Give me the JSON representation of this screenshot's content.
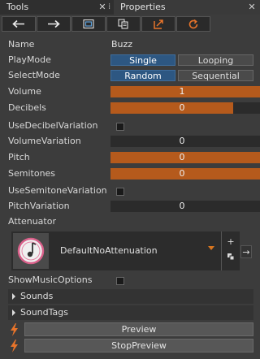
{
  "tabs": {
    "tools": "Tools",
    "properties": "Properties",
    "close_glyph": "✕"
  },
  "toolbar": {
    "icons": [
      "arrow-left-icon",
      "arrow-right-icon",
      "select-frame-icon",
      "copy-paste-icon",
      "open-external-icon",
      "refresh-icon"
    ]
  },
  "properties": {
    "name": {
      "label": "Name",
      "value": "Buzz"
    },
    "play_mode": {
      "label": "PlayMode",
      "options": [
        "Single",
        "Looping"
      ],
      "selected": "Single"
    },
    "select_mode": {
      "label": "SelectMode",
      "options": [
        "Random",
        "Sequential"
      ],
      "selected": "Random"
    },
    "volume": {
      "label": "Volume",
      "value": "1",
      "fill": 1.0
    },
    "decibels": {
      "label": "Decibels",
      "value": "0",
      "fill": 0.82
    },
    "use_decibel_variation": {
      "label": "UseDecibelVariation",
      "checked": false
    },
    "volume_variation": {
      "label": "VolumeVariation",
      "value": "0",
      "fill": 0
    },
    "pitch": {
      "label": "Pitch",
      "value": "0",
      "fill": 1.0
    },
    "semitones": {
      "label": "Semitones",
      "value": "0",
      "fill": 1.0
    },
    "use_semitone_variation": {
      "label": "UseSemitoneVariation",
      "checked": false
    },
    "pitch_variation": {
      "label": "PitchVariation",
      "value": "0",
      "fill": 0
    },
    "attenuator": {
      "label": "Attenuator",
      "value": "DefaultNoAttenuation",
      "add_glyph": "+",
      "goto_glyph": "→"
    },
    "show_music_options": {
      "label": "ShowMusicOptions",
      "checked": false
    }
  },
  "sections": {
    "sounds": "Sounds",
    "sound_tags": "SoundTags"
  },
  "actions": {
    "preview": "Preview",
    "stop_preview": "StopPreview"
  },
  "colors": {
    "accent_orange": "#b55a1c",
    "toggle_on": "#2d5782",
    "bolt": "#e8742a"
  }
}
